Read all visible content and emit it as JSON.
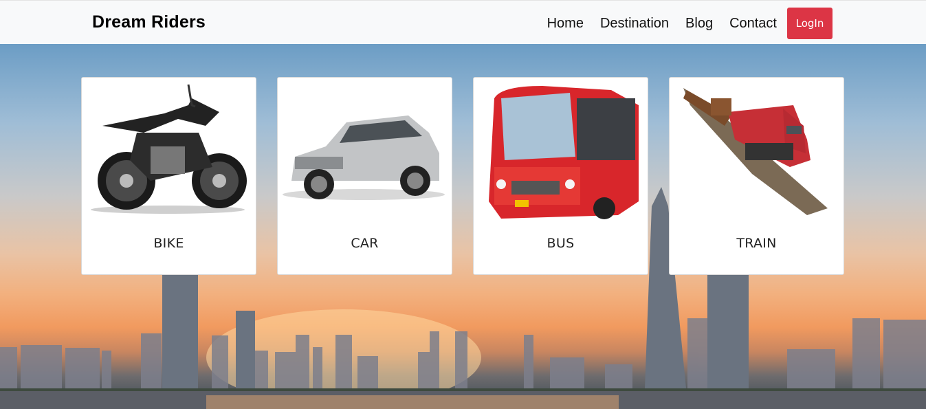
{
  "brand": {
    "name": "Dream Riders"
  },
  "nav": {
    "items": [
      {
        "label": "Home"
      },
      {
        "label": "Destination"
      },
      {
        "label": "Blog"
      },
      {
        "label": "Contact"
      }
    ],
    "login_label": "LogIn"
  },
  "cards": [
    {
      "label": "BIKE",
      "icon": "motorcycle-image"
    },
    {
      "label": "CAR",
      "icon": "car-image"
    },
    {
      "label": "BUS",
      "icon": "bus-image"
    },
    {
      "label": "TRAIN",
      "icon": "train-image"
    }
  ],
  "colors": {
    "login_bg": "#dc3545",
    "navbar_bg": "#f8f9fa"
  }
}
